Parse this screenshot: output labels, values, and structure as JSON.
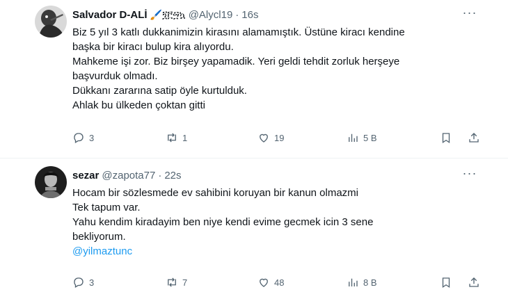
{
  "tweets": [
    {
      "name": "Salvador D-ALİ",
      "name_emoji": "🖌️፺፫፵ኳ",
      "handle": "@Alycl19",
      "separator": "·",
      "time": "16s",
      "more": "···",
      "lines": [
        "Biz 5 yıl 3 katlı dukkanimizin kirasını alamamıştık. Üstüne kiracı kendine",
        "başka bir kiracı bulup kira alıyordu.",
        "Mahkeme işi zor. Biz birşey yapamadik. Yeri geldi tehdit zorluk herşeye",
        "başvurduk olmadı.",
        "Dükkanı zararına satip öyle kurtulduk.",
        "Ahlak bu ülkeden çoktan gitti"
      ],
      "replies": "3",
      "reposts": "1",
      "likes": "19",
      "views": "5 B"
    },
    {
      "name": "sezar",
      "handle": "@zapota77",
      "separator": "·",
      "time": "22s",
      "more": "···",
      "lines": [
        "Hocam bir sözlesmede ev sahibini koruyan bir kanun olmazmi",
        "Tek tapum var.",
        "Yahu kendim kiradayim ben niye kendi evime gecmek icin 3 sene",
        "bekliyorum."
      ],
      "mention": "@yilmaztunc",
      "replies": "3",
      "reposts": "7",
      "likes": "48",
      "views": "8 B"
    }
  ],
  "colors": {
    "text": "#0f1419",
    "secondary": "#536471",
    "link": "#1d9bf0",
    "divider": "#eff3f4"
  },
  "icons": [
    "reply-icon",
    "repost-icon",
    "like-icon",
    "views-icon",
    "bookmark-icon",
    "share-icon",
    "more-icon"
  ]
}
